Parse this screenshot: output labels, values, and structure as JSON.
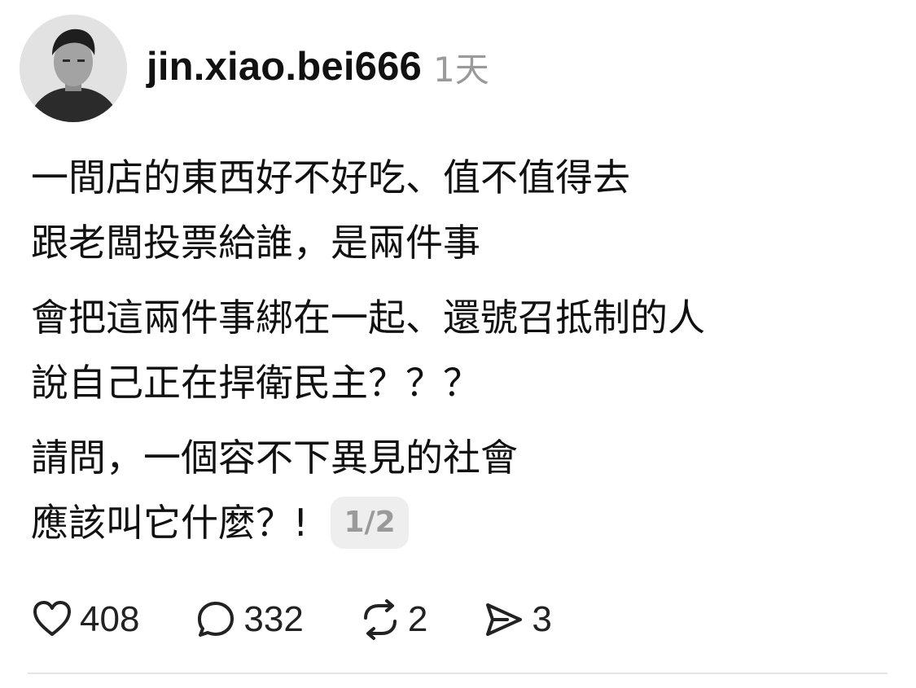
{
  "post": {
    "username": "jin.xiao.bei666",
    "timestamp": "1天",
    "paragraphs": [
      [
        "一間店的東西好不好吃、值不值得去",
        "跟老闆投票給誰，是兩件事"
      ],
      [
        "會把這兩件事綁在一起、還號召抵制的人",
        "說自己正在捍衛民主？？？"
      ],
      [
        "請問，一個容不下異見的社會",
        "應該叫它什麼？!"
      ]
    ],
    "page_indicator": "1/2"
  },
  "actions": {
    "likes": "408",
    "comments": "332",
    "reposts": "2",
    "shares": "3"
  },
  "icons": {
    "like": "heart-icon",
    "comment": "speech-bubble-icon",
    "repost": "repost-icon",
    "share": "send-icon"
  },
  "colors": {
    "text": "#111111",
    "muted": "#9a9a9a",
    "badge_bg": "#eeeeee",
    "divider": "#e5e5e5"
  }
}
